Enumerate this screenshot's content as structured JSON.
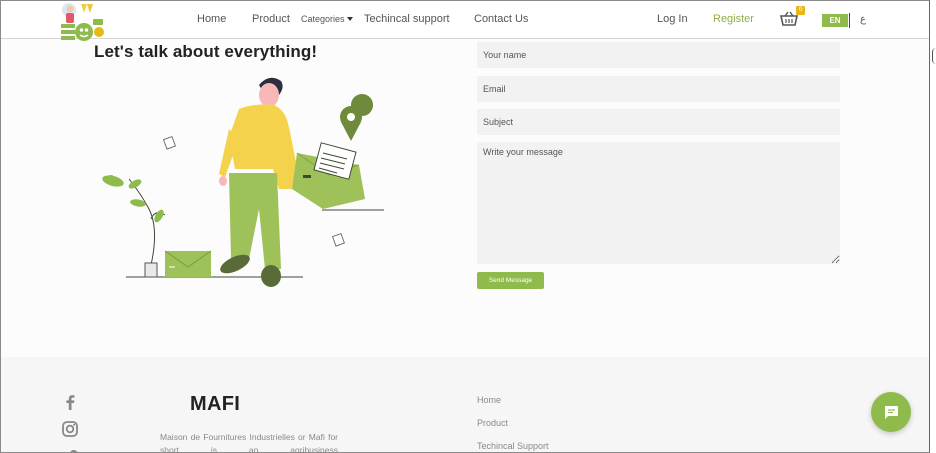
{
  "nav": {
    "home": "Home",
    "product": "Product",
    "categories": "Categories",
    "tech_support": "Techincal support",
    "contact": "Contact Us",
    "login": "Log In",
    "register": "Register",
    "cart_count": "0",
    "lang_active": "EN",
    "lang_alt": "ع"
  },
  "contact": {
    "heading": "Let's talk about everything!",
    "name_placeholder": "Your name",
    "email_placeholder": "Email",
    "subject_placeholder": "Subject",
    "message_placeholder": "Write your message",
    "send_label": "Send Message"
  },
  "footer": {
    "brand": "MAFI",
    "about": "Maison de Fournitures Industrielles or Mafi for short is an agribusiness",
    "links": [
      "Home",
      "Product",
      "Techincal Support"
    ]
  },
  "colors": {
    "accent": "#8fba4c",
    "badge": "#e7b81a",
    "figure_shirt": "#f5d24b",
    "footer_bg": "#f6f6f6"
  },
  "icons": {
    "cart": "basket-icon",
    "chat": "chat-bubble-icon",
    "social": [
      "facebook-icon",
      "instagram-icon",
      "twitter-icon"
    ]
  }
}
